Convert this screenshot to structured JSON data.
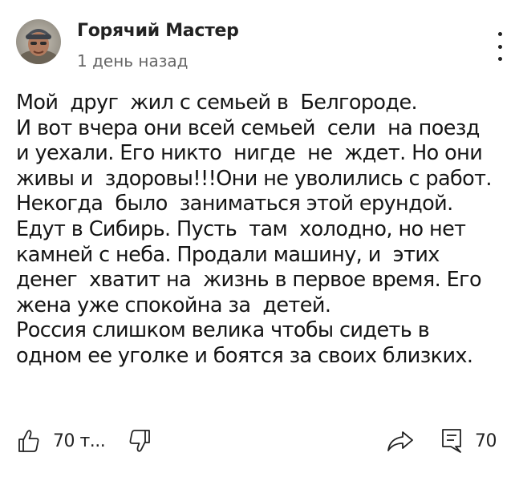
{
  "comment": {
    "author": "Горячий Мастер",
    "time": "1 день назад",
    "text": "Мой  друг  жил с семьей в  Белгороде.\nИ вот вчера они всей семьей  сели  на поезд\nи уехали. Его никто  нигде  не  ждет. Но они\nживы и  здоровы!!!Они не уволились с работ.\nНекогда  было  заниматься этой ерундой.\nЕдут в Сибирь. Пусть  там  холодно, но нет\nкамней с неба. Продали машину, и  этих\nденег  хватит на  жизнь в первое время. Его\nжена уже спокойна за  детей.\nРоссия слишком велика чтобы сидеть в\nодном ее уголке и боятся за своих близких."
  },
  "actions": {
    "like_count": "70 т...",
    "reply_count": "70"
  },
  "icons": {
    "avatar": "avatar",
    "menu": "more-vertical-icon",
    "like": "thumbs-up-icon",
    "dislike": "thumbs-down-icon",
    "share": "share-icon",
    "reply": "comment-icon"
  }
}
